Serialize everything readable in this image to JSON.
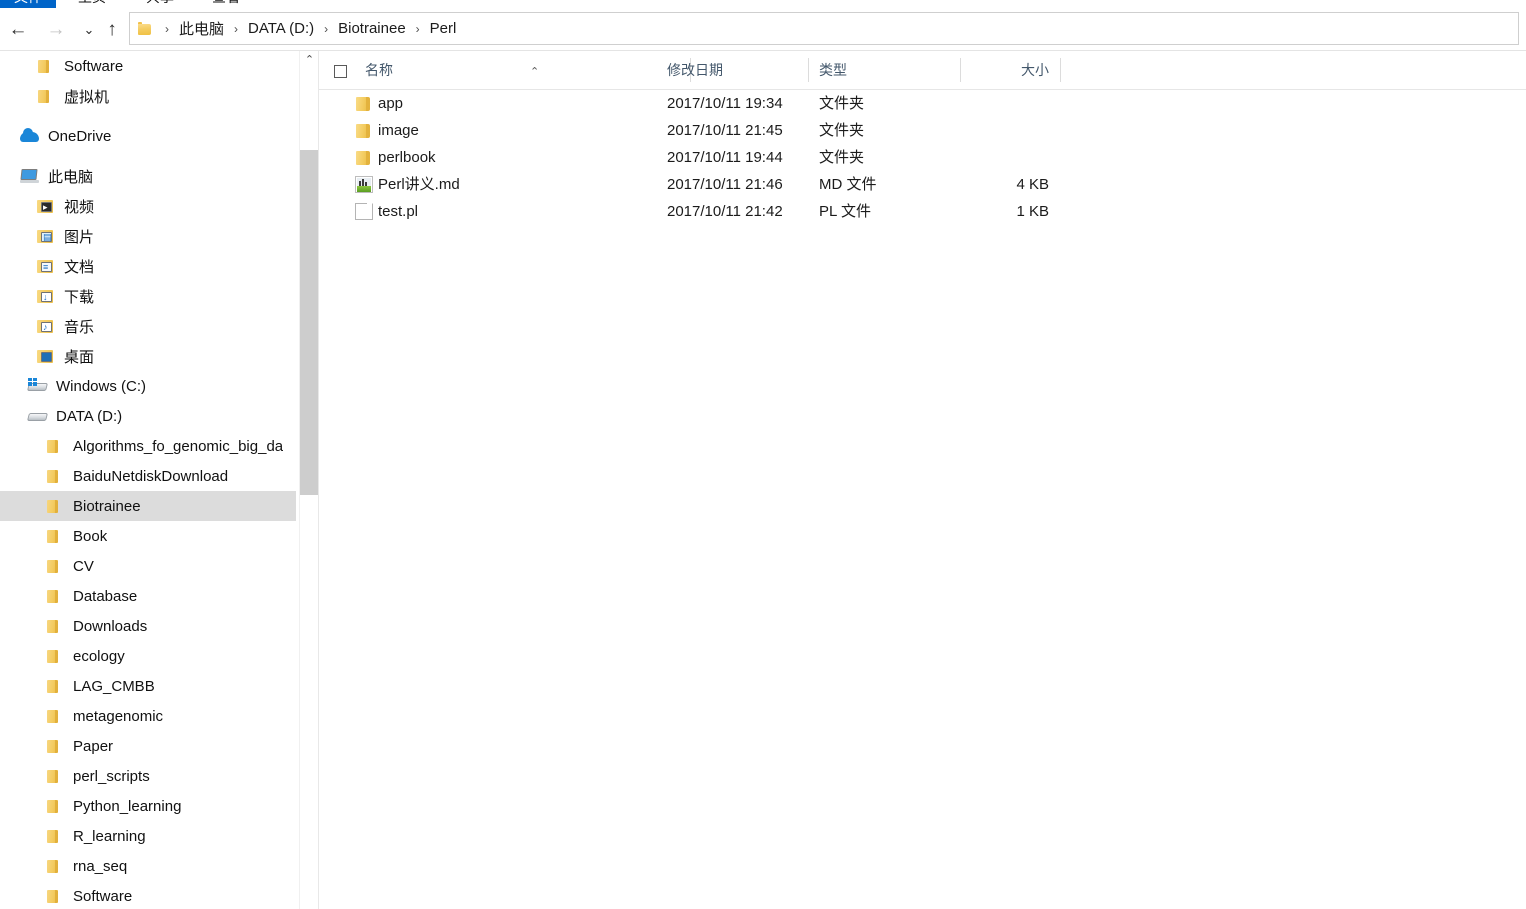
{
  "ribbon": {
    "tabs": [
      {
        "label": "文件",
        "active": true
      },
      {
        "label": "主页",
        "active": false
      },
      {
        "label": "共享",
        "active": false
      },
      {
        "label": "查看",
        "active": false
      }
    ],
    "active_tab_color": "#0064c8"
  },
  "navbar": {
    "back_icon": "←",
    "forward_icon": "→",
    "recent_icon": "⌄",
    "up_icon": "↑",
    "breadcrumb_icon": "folder-icon",
    "separator": "›",
    "breadcrumbs": [
      "此电脑",
      "DATA (D:)",
      "Biotrainee",
      "Perl"
    ]
  },
  "navpane": {
    "scroll_up_icon": "⌃",
    "items": [
      {
        "label": "Software",
        "icon": "folder-icon",
        "indent": 36,
        "selected": false
      },
      {
        "label": "虚拟机",
        "icon": "folder-icon",
        "indent": 36,
        "selected": false
      },
      {
        "label": "OneDrive",
        "icon": "cloud-icon",
        "indent": 20,
        "selected": false,
        "spacer_before": true
      },
      {
        "label": "此电脑",
        "icon": "computer-icon",
        "indent": 20,
        "selected": false,
        "spacer_before": true
      },
      {
        "label": "视频",
        "icon": "video-folder-icon",
        "indent": 36,
        "selected": false
      },
      {
        "label": "图片",
        "icon": "pictures-folder-icon",
        "indent": 36,
        "selected": false
      },
      {
        "label": "文档",
        "icon": "documents-folder-icon",
        "indent": 36,
        "selected": false
      },
      {
        "label": "下载",
        "icon": "downloads-folder-icon",
        "indent": 36,
        "selected": false
      },
      {
        "label": "音乐",
        "icon": "music-folder-icon",
        "indent": 36,
        "selected": false
      },
      {
        "label": "桌面",
        "icon": "desktop-folder-icon",
        "indent": 36,
        "selected": false
      },
      {
        "label": "Windows (C:)",
        "icon": "windows-drive-icon",
        "indent": 28,
        "selected": false
      },
      {
        "label": "DATA (D:)",
        "icon": "drive-icon",
        "indent": 28,
        "selected": false
      },
      {
        "label": "Algorithms_fo_genomic_big_da",
        "icon": "folder-icon",
        "indent": 45,
        "selected": false
      },
      {
        "label": "BaiduNetdiskDownload",
        "icon": "folder-icon",
        "indent": 45,
        "selected": false
      },
      {
        "label": "Biotrainee",
        "icon": "folder-icon",
        "indent": 45,
        "selected": true
      },
      {
        "label": "Book",
        "icon": "folder-icon",
        "indent": 45,
        "selected": false
      },
      {
        "label": "CV",
        "icon": "folder-icon",
        "indent": 45,
        "selected": false
      },
      {
        "label": "Database",
        "icon": "folder-icon",
        "indent": 45,
        "selected": false
      },
      {
        "label": "Downloads",
        "icon": "folder-icon",
        "indent": 45,
        "selected": false
      },
      {
        "label": "ecology",
        "icon": "folder-icon",
        "indent": 45,
        "selected": false
      },
      {
        "label": "LAG_CMBB",
        "icon": "folder-icon",
        "indent": 45,
        "selected": false
      },
      {
        "label": "metagenomic",
        "icon": "folder-icon",
        "indent": 45,
        "selected": false
      },
      {
        "label": "Paper",
        "icon": "folder-icon",
        "indent": 45,
        "selected": false
      },
      {
        "label": "perl_scripts",
        "icon": "folder-icon",
        "indent": 45,
        "selected": false
      },
      {
        "label": "Python_learning",
        "icon": "folder-icon",
        "indent": 45,
        "selected": false
      },
      {
        "label": "R_learning",
        "icon": "folder-icon",
        "indent": 45,
        "selected": false
      },
      {
        "label": "rna_seq",
        "icon": "folder-icon",
        "indent": 45,
        "selected": false
      },
      {
        "label": "Software",
        "icon": "folder-icon",
        "indent": 45,
        "selected": false
      }
    ],
    "selection_color": "#dcdcdc"
  },
  "filelist": {
    "columns": {
      "name": "名称",
      "date": "修改日期",
      "type": "类型",
      "size": "大小"
    },
    "sort_indicator": "⌃",
    "rows": [
      {
        "name": "app",
        "date": "2017/10/11 19:34",
        "type": "文件夹",
        "size": "",
        "icon": "folder-icon"
      },
      {
        "name": "image",
        "date": "2017/10/11 21:45",
        "type": "文件夹",
        "size": "",
        "icon": "folder-icon"
      },
      {
        "name": "perlbook",
        "date": "2017/10/11 19:44",
        "type": "文件夹",
        "size": "",
        "icon": "folder-icon"
      },
      {
        "name": "Perl讲义.md",
        "date": "2017/10/11 21:46",
        "type": "MD 文件",
        "size": "4 KB",
        "icon": "markdown-file-icon"
      },
      {
        "name": "test.pl",
        "date": "2017/10/11 21:42",
        "type": "PL 文件",
        "size": "1 KB",
        "icon": "generic-file-icon"
      }
    ]
  }
}
